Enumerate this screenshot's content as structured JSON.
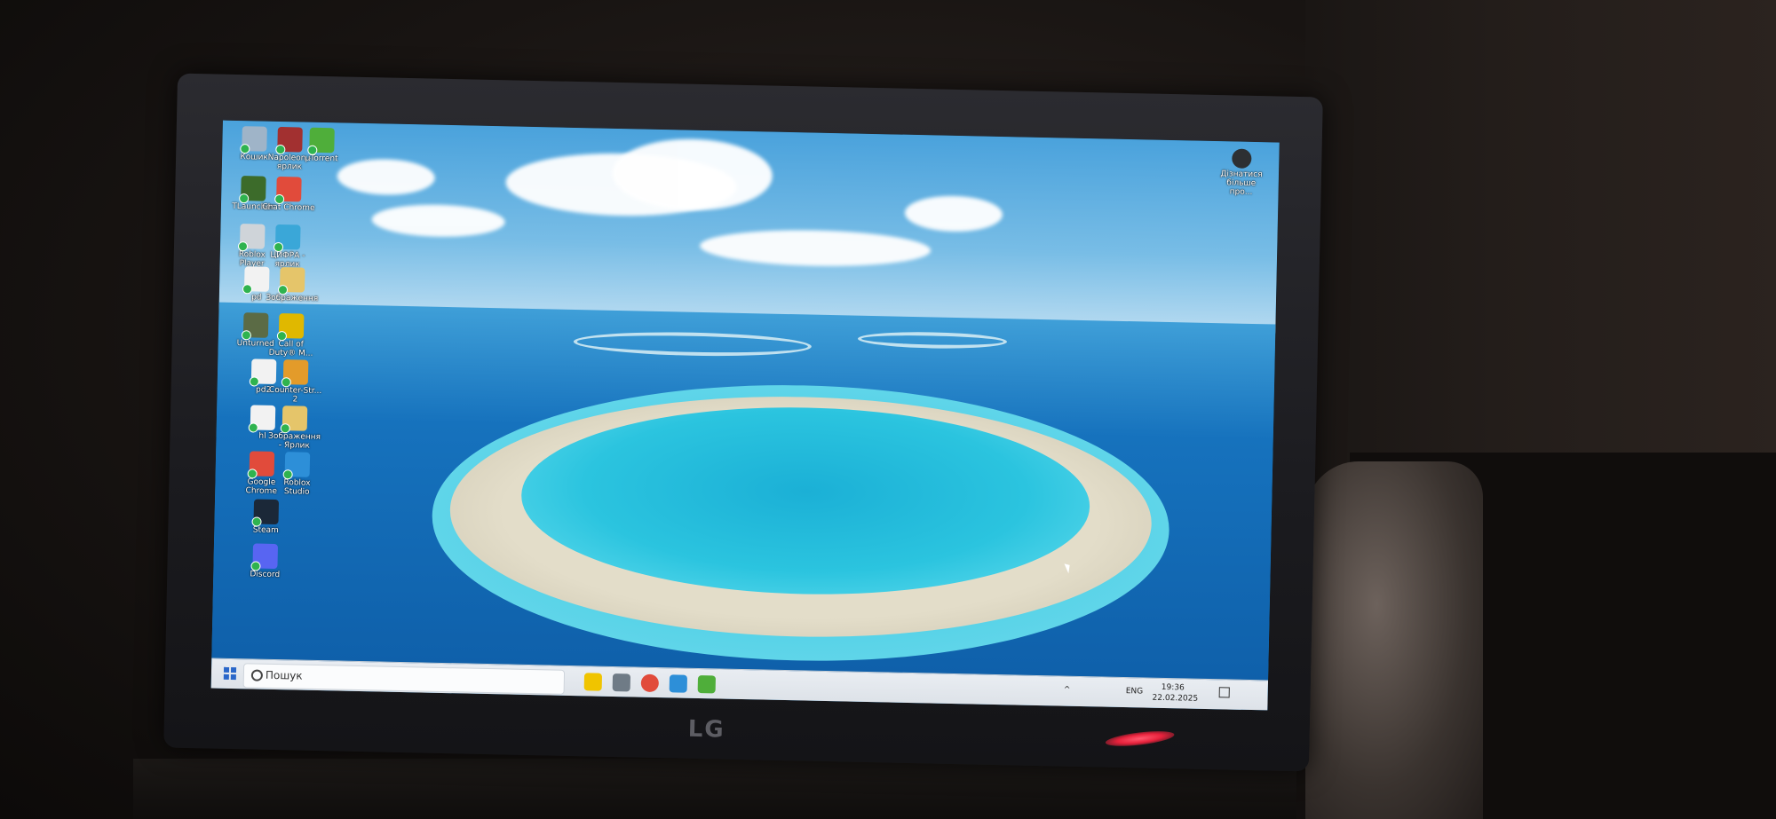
{
  "monitor": {
    "brand": "LG"
  },
  "desktop": {
    "icons": [
      {
        "label": "Кошик",
        "icon": "recycle-bin-icon",
        "color": "#9fb4c8"
      },
      {
        "label": "Napoleon - ярлик",
        "icon": "game-icon",
        "color": "#a23030"
      },
      {
        "label": "µTorrent",
        "icon": "utorrent-icon",
        "color": "#4fae3a"
      },
      {
        "label": "TLauncher",
        "icon": "minecraft-icon",
        "color": "#3c6b2a"
      },
      {
        "label": "Chat Chrome",
        "icon": "chrome-icon",
        "color": "#e14b3b"
      },
      {
        "label": "Roblox Player",
        "icon": "roblox-icon",
        "color": "#cfd4d9"
      },
      {
        "label": "ЦИФРА - ярлик",
        "icon": "shortcut-icon",
        "color": "#3aa7d8"
      },
      {
        "label": "pd",
        "icon": "file-icon",
        "color": "#f2f2f2"
      },
      {
        "label": "Зображення",
        "icon": "images-folder-icon",
        "color": "#e5c56a"
      },
      {
        "label": "Unturned",
        "icon": "unturned-icon",
        "color": "#5b6b45"
      },
      {
        "label": "Call of Duty® M...",
        "icon": "cod-icon",
        "color": "#e0b800"
      },
      {
        "label": "pd2",
        "icon": "file-icon",
        "color": "#f2f2f2"
      },
      {
        "label": "Counter-Str... 2",
        "icon": "cs2-icon",
        "color": "#e39b2a"
      },
      {
        "label": "hl",
        "icon": "file-icon",
        "color": "#f2f2f2"
      },
      {
        "label": "Зображення - Ярлик",
        "icon": "images-folder-icon",
        "color": "#e5c56a"
      },
      {
        "label": "Google Chrome",
        "icon": "chrome-icon",
        "color": "#e14b3b"
      },
      {
        "label": "Roblox Studio",
        "icon": "roblox-studio-icon",
        "color": "#2d8fd8"
      },
      {
        "label": "Steam",
        "icon": "steam-icon",
        "color": "#1b2838"
      },
      {
        "label": "Discord",
        "icon": "discord-icon",
        "color": "#5865f2"
      }
    ],
    "corner_icon": {
      "label": "Дізнатися більше про...",
      "icon": "learn-more-icon"
    }
  },
  "taskbar": {
    "search_placeholder": "Пошук",
    "tray_lang": "ENG",
    "time": "19:36",
    "date": "22.02.2025"
  }
}
